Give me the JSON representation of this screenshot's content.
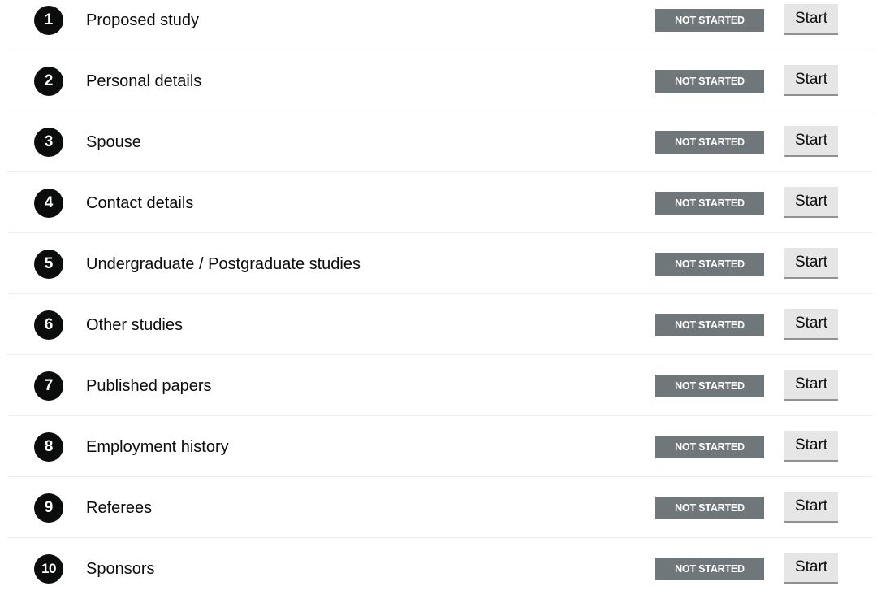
{
  "tasks": [
    {
      "number": "1",
      "label": "Proposed study",
      "status": "NOT STARTED",
      "action": "Start"
    },
    {
      "number": "2",
      "label": "Personal details",
      "status": "NOT STARTED",
      "action": "Start"
    },
    {
      "number": "3",
      "label": "Spouse",
      "status": "NOT STARTED",
      "action": "Start"
    },
    {
      "number": "4",
      "label": "Contact details",
      "status": "NOT STARTED",
      "action": "Start"
    },
    {
      "number": "5",
      "label": "Undergraduate / Postgraduate studies",
      "status": "NOT STARTED",
      "action": "Start"
    },
    {
      "number": "6",
      "label": "Other studies",
      "status": "NOT STARTED",
      "action": "Start"
    },
    {
      "number": "7",
      "label": "Published papers",
      "status": "NOT STARTED",
      "action": "Start"
    },
    {
      "number": "8",
      "label": "Employment history",
      "status": "NOT STARTED",
      "action": "Start"
    },
    {
      "number": "9",
      "label": "Referees",
      "status": "NOT STARTED",
      "action": "Start"
    },
    {
      "number": "10",
      "label": "Sponsors",
      "status": "NOT STARTED",
      "action": "Start"
    }
  ],
  "colors": {
    "status_badge": "#6f777b",
    "number_circle": "#0b0c0c",
    "button": "#e6e6e6"
  }
}
